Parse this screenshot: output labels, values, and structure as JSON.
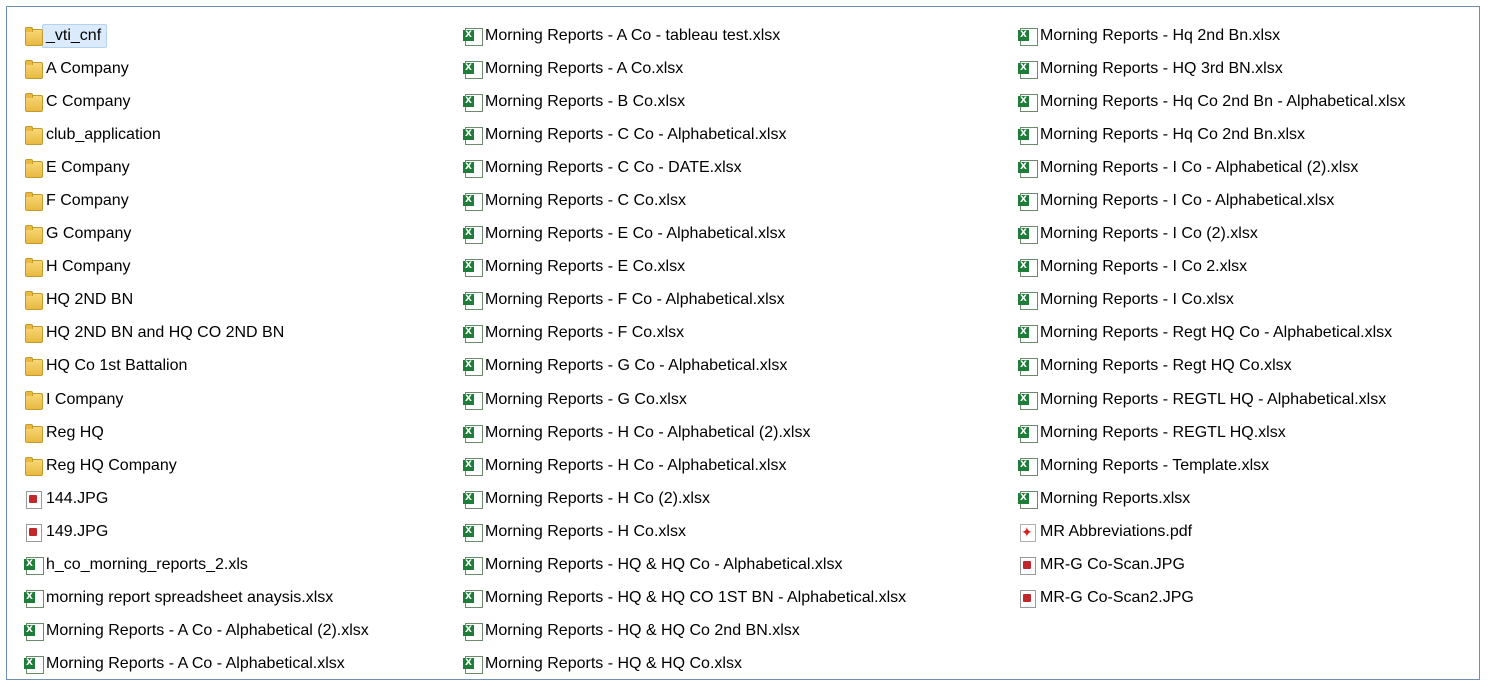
{
  "column1": [
    {
      "name": "_vti_cnf",
      "type": "folder",
      "selected": true
    },
    {
      "name": "A Company",
      "type": "folder"
    },
    {
      "name": "C Company",
      "type": "folder"
    },
    {
      "name": "club_application",
      "type": "folder"
    },
    {
      "name": "E Company",
      "type": "folder"
    },
    {
      "name": "F Company",
      "type": "folder"
    },
    {
      "name": "G Company",
      "type": "folder"
    },
    {
      "name": "H Company",
      "type": "folder"
    },
    {
      "name": "HQ 2ND BN",
      "type": "folder"
    },
    {
      "name": "HQ 2ND BN and HQ CO 2ND BN",
      "type": "folder"
    },
    {
      "name": "HQ Co 1st Battalion",
      "type": "folder"
    },
    {
      "name": "I Company",
      "type": "folder"
    },
    {
      "name": "Reg HQ",
      "type": "folder"
    },
    {
      "name": "Reg HQ Company",
      "type": "folder"
    },
    {
      "name": "144.JPG",
      "type": "jpg"
    },
    {
      "name": "149.JPG",
      "type": "jpg"
    },
    {
      "name": "h_co_morning_reports_2.xls",
      "type": "excel"
    },
    {
      "name": "morning report spreadsheet anaysis.xlsx",
      "type": "excel"
    },
    {
      "name": "Morning Reports - A Co - Alphabetical (2).xlsx",
      "type": "excel"
    },
    {
      "name": "Morning Reports - A Co - Alphabetical.xlsx",
      "type": "excel"
    }
  ],
  "column2": [
    {
      "name": "Morning Reports - A Co - tableau test.xlsx",
      "type": "excel"
    },
    {
      "name": "Morning Reports - A Co.xlsx",
      "type": "excel"
    },
    {
      "name": "Morning Reports - B Co.xlsx",
      "type": "excel"
    },
    {
      "name": "Morning Reports - C Co - Alphabetical.xlsx",
      "type": "excel"
    },
    {
      "name": "Morning Reports - C Co - DATE.xlsx",
      "type": "excel"
    },
    {
      "name": "Morning Reports - C Co.xlsx",
      "type": "excel"
    },
    {
      "name": "Morning Reports - E Co - Alphabetical.xlsx",
      "type": "excel"
    },
    {
      "name": "Morning Reports - E Co.xlsx",
      "type": "excel"
    },
    {
      "name": "Morning Reports - F Co - Alphabetical.xlsx",
      "type": "excel"
    },
    {
      "name": "Morning Reports - F Co.xlsx",
      "type": "excel"
    },
    {
      "name": "Morning Reports - G Co - Alphabetical.xlsx",
      "type": "excel"
    },
    {
      "name": "Morning Reports - G Co.xlsx",
      "type": "excel"
    },
    {
      "name": "Morning Reports - H Co - Alphabetical (2).xlsx",
      "type": "excel"
    },
    {
      "name": "Morning Reports - H Co - Alphabetical.xlsx",
      "type": "excel"
    },
    {
      "name": "Morning Reports - H Co (2).xlsx",
      "type": "excel"
    },
    {
      "name": "Morning Reports - H Co.xlsx",
      "type": "excel"
    },
    {
      "name": "Morning Reports - HQ & HQ Co - Alphabetical.xlsx",
      "type": "excel"
    },
    {
      "name": "Morning Reports - HQ & HQ CO 1ST BN - Alphabetical.xlsx",
      "type": "excel"
    },
    {
      "name": "Morning Reports - HQ & HQ Co 2nd BN.xlsx",
      "type": "excel"
    },
    {
      "name": "Morning Reports - HQ & HQ Co.xlsx",
      "type": "excel"
    }
  ],
  "column3": [
    {
      "name": "Morning Reports - Hq 2nd Bn.xlsx",
      "type": "excel"
    },
    {
      "name": "Morning Reports - HQ 3rd BN.xlsx",
      "type": "excel"
    },
    {
      "name": "Morning Reports - Hq Co 2nd Bn - Alphabetical.xlsx",
      "type": "excel"
    },
    {
      "name": "Morning Reports - Hq Co 2nd Bn.xlsx",
      "type": "excel"
    },
    {
      "name": "Morning Reports - I Co - Alphabetical (2).xlsx",
      "type": "excel"
    },
    {
      "name": "Morning Reports - I Co - Alphabetical.xlsx",
      "type": "excel"
    },
    {
      "name": "Morning Reports - I Co (2).xlsx",
      "type": "excel"
    },
    {
      "name": "Morning Reports - I Co 2.xlsx",
      "type": "excel"
    },
    {
      "name": "Morning Reports - I Co.xlsx",
      "type": "excel"
    },
    {
      "name": "Morning Reports - Regt HQ Co - Alphabetical.xlsx",
      "type": "excel"
    },
    {
      "name": "Morning Reports - Regt HQ Co.xlsx",
      "type": "excel"
    },
    {
      "name": "Morning Reports - REGTL HQ - Alphabetical.xlsx",
      "type": "excel"
    },
    {
      "name": "Morning Reports - REGTL HQ.xlsx",
      "type": "excel"
    },
    {
      "name": "Morning Reports - Template.xlsx",
      "type": "excel"
    },
    {
      "name": "Morning Reports.xlsx",
      "type": "excel"
    },
    {
      "name": "MR Abbreviations.pdf",
      "type": "pdf"
    },
    {
      "name": "MR-G Co-Scan.JPG",
      "type": "jpg"
    },
    {
      "name": "MR-G Co-Scan2.JPG",
      "type": "jpg"
    }
  ]
}
